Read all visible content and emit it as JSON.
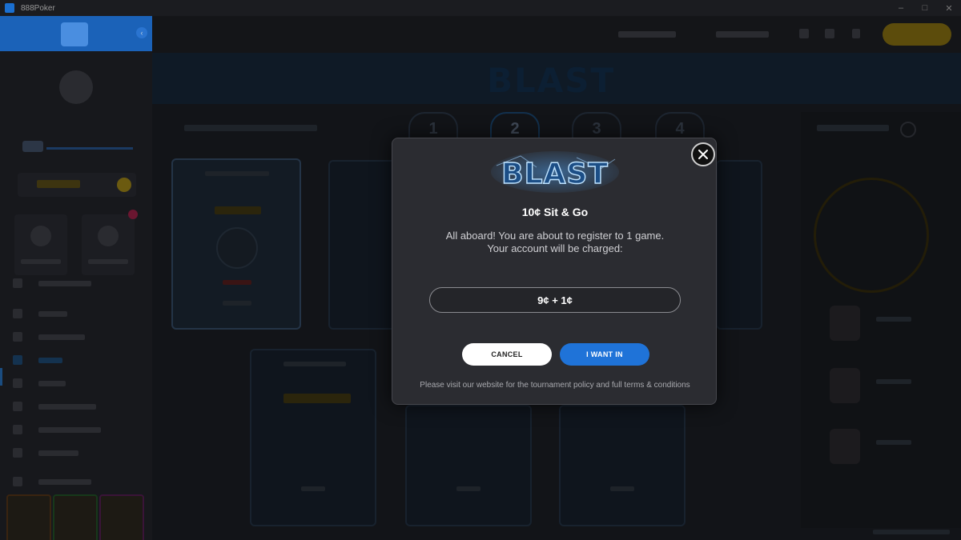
{
  "window": {
    "title": "888Poker",
    "minimize": "–",
    "maximize": "□",
    "close": "✕"
  },
  "sidebar": {
    "collapse_icon": "chevron-left-icon"
  },
  "main": {
    "logo_text": "BLAST",
    "steps": [
      "1",
      "2",
      "3",
      "4"
    ]
  },
  "modal": {
    "logo_text": "BLAST",
    "title": "10¢ Sit & Go",
    "message_line1": "All aboard! You are about to register to 1 game.",
    "message_line2": "Your account will be charged:",
    "charge": "9¢ + 1¢",
    "cancel_label": "CANCEL",
    "confirm_label": "I WANT IN",
    "policy": "Please visit our website for the tournament policy and full terms & conditions",
    "close_icon": "close-icon"
  },
  "colors": {
    "accent_blue": "#1f73d8",
    "modal_bg": "#2b2c31",
    "sidebar_blue": "#1b62b8",
    "cashier_gold": "#f2c200"
  }
}
